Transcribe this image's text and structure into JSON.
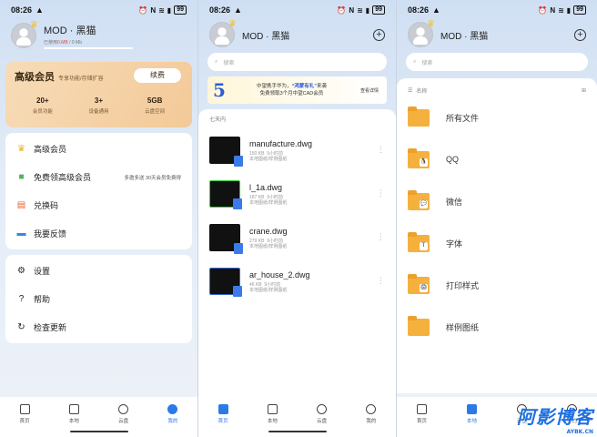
{
  "status": {
    "time": "08:26",
    "battery": "99"
  },
  "user": {
    "name": "MOD · 黑猫"
  },
  "screen1": {
    "quota_prefix": "已使用",
    "quota_used": "0.MB",
    "quota_total": "/ 0 Mb",
    "premium": {
      "title": "高级会员",
      "subtitle": "专享功能/存储扩容",
      "renew": "续费",
      "stats": [
        {
          "value": "20+",
          "label": "会员功能"
        },
        {
          "value": "3+",
          "label": "设备通用"
        },
        {
          "value": "5GB",
          "label": "云盘空间"
        }
      ]
    },
    "menu1": [
      {
        "label": "高级会员",
        "icon": "crown-icon",
        "extra": ""
      },
      {
        "label": "免费领高级会员",
        "icon": "gift-icon",
        "extra": "多邀多送 30天会员免费得"
      },
      {
        "label": "兑换码",
        "icon": "ticket-icon",
        "extra": ""
      },
      {
        "label": "我要反馈",
        "icon": "chat-icon",
        "extra": ""
      }
    ],
    "menu2": [
      {
        "label": "设置",
        "icon": "gear-icon"
      },
      {
        "label": "帮助",
        "icon": "help-icon"
      },
      {
        "label": "检查更新",
        "icon": "update-icon"
      }
    ]
  },
  "screen2": {
    "search_placeholder": "搜索",
    "banner": {
      "line1_a": "中望携手华为，",
      "line1_b": "“鸿蒙有礼”",
      "line1_c": "来袭",
      "line2": "免费领取3个月中望CAD会员",
      "detail": "查看详情"
    },
    "section": "七天内",
    "files": [
      {
        "name": "manufacture.dwg",
        "size": "150 KB",
        "time": "9小时前",
        "path": "本地图纸/样例图纸"
      },
      {
        "name": "l_1a.dwg",
        "size": "187 KB",
        "time": "9小时前",
        "path": "本地图纸/样例图纸"
      },
      {
        "name": "crane.dwg",
        "size": "279 KB",
        "time": "9小时前",
        "path": "本地图纸/样例图纸"
      },
      {
        "name": "ar_house_2.dwg",
        "size": "46 KB",
        "time": "9小时前",
        "path": "本地图纸/样例图纸"
      }
    ]
  },
  "screen3": {
    "search_placeholder": "搜索",
    "sort_label": "名称",
    "folders": [
      {
        "name": "所有文件",
        "badge": ""
      },
      {
        "name": "QQ",
        "badge": "🐧"
      },
      {
        "name": "微信",
        "badge": "💬"
      },
      {
        "name": "字体",
        "badge": "T"
      },
      {
        "name": "打印样式",
        "badge": "🖨"
      },
      {
        "name": "样例图纸",
        "badge": ""
      }
    ]
  },
  "nav": [
    {
      "label": "首页"
    },
    {
      "label": "本地"
    },
    {
      "label": "云盘"
    },
    {
      "label": "我的"
    }
  ],
  "watermark": {
    "text": "阿影博客",
    "sub": "AYBK.CN"
  },
  "colors": {
    "accent": "#2b7ae8",
    "premium": "#f3c998"
  }
}
